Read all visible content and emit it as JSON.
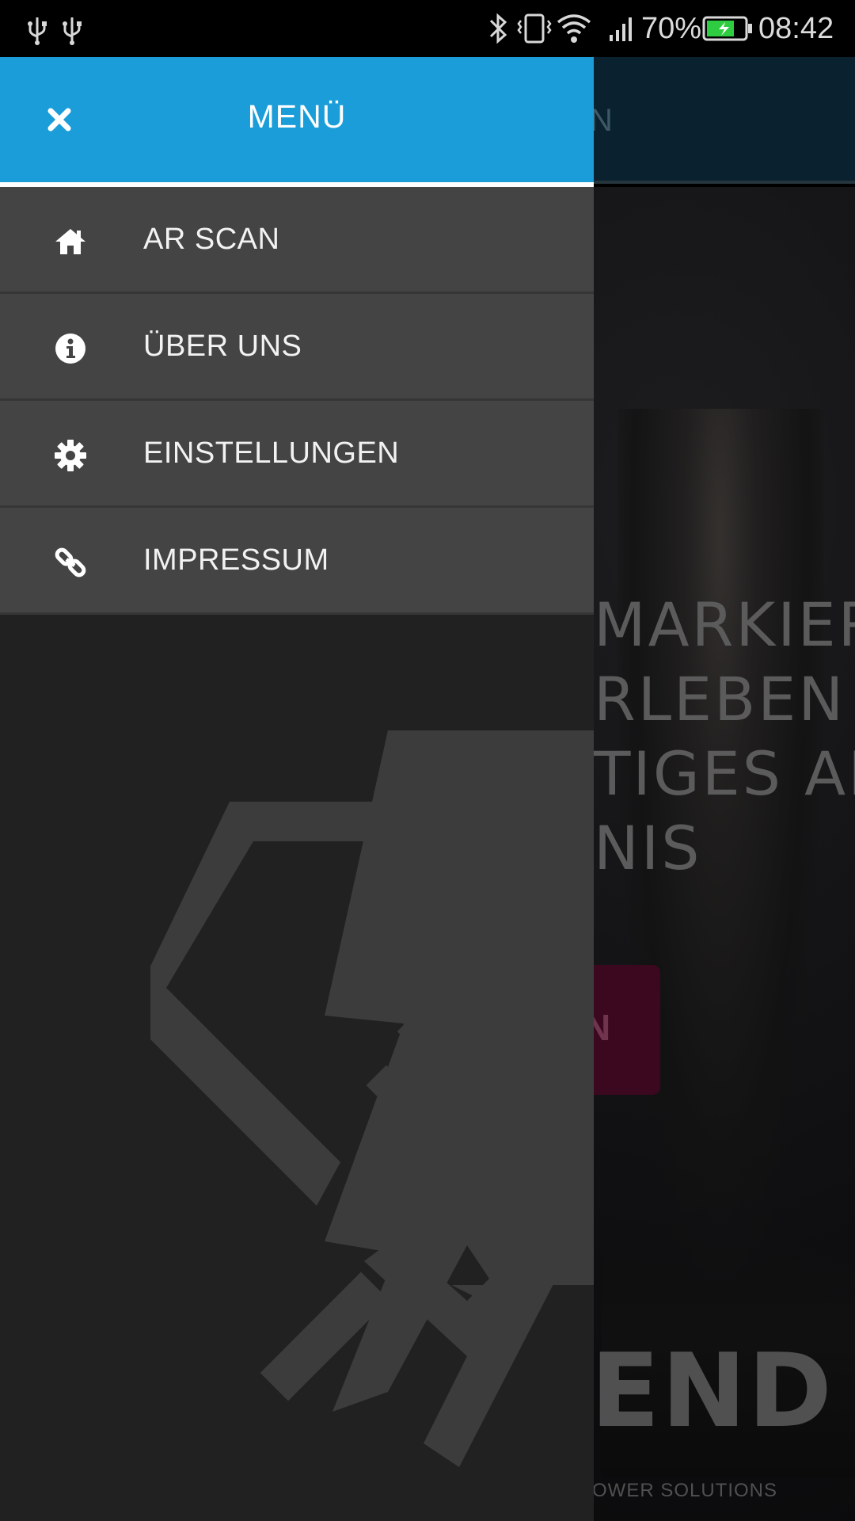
{
  "status_bar": {
    "battery_percent": "70%",
    "time": "08:42",
    "icons": [
      "usb-icon",
      "usb-icon",
      "bluetooth-icon",
      "vibrate-icon",
      "wifi-icon",
      "signal-icon",
      "battery-charging-icon"
    ]
  },
  "drawer": {
    "title": "MENÜ",
    "close_icon": "close-icon",
    "accent_color": "#1b9dd9",
    "items": [
      {
        "label": "AR SCAN",
        "icon": "home-icon"
      },
      {
        "label": "ÜBER UNS",
        "icon": "info-icon"
      },
      {
        "label": "EINSTELLUNGEN",
        "icon": "gear-icon"
      },
      {
        "label": "IMPRESSUM",
        "icon": "link-icon"
      }
    ]
  },
  "background": {
    "header_text": "N",
    "headline_lines": [
      "MARKIERT",
      "RLEBEN S",
      "TIGES AR",
      "NIS"
    ],
    "button_text": "N",
    "logo_text": "END",
    "logo_subtitle": "OWER SOLUTIONS"
  }
}
